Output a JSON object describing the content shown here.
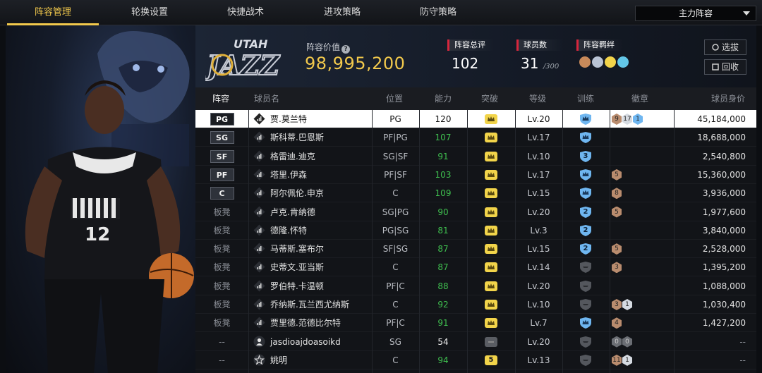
{
  "nav": {
    "tabs": [
      "阵容管理",
      "轮换设置",
      "快捷战术",
      "进攻策略",
      "防守策略"
    ],
    "active_tab": "阵容管理",
    "lineup_select": "主力阵容"
  },
  "summary": {
    "team_logo_text": "UTAH JAZZ",
    "value_label": "阵容价值",
    "value": "98,995,200",
    "overall_label": "阵容总评",
    "overall": "102",
    "players_label": "球员数",
    "players_count": "31",
    "players_max": "/300",
    "bond_label": "阵容羁绊",
    "buttons": {
      "select": "选拔",
      "recycle": "回收"
    }
  },
  "table": {
    "headers": [
      "阵容",
      "球员名",
      "位置",
      "能力",
      "突破",
      "等级",
      "训练",
      "徽章",
      "球员身价"
    ],
    "rows": [
      {
        "slot": "PG",
        "name": "贾.莫兰特",
        "pos": "PG",
        "ability": "120",
        "break": "crown",
        "level": "Lv.20",
        "train": "crown-blue",
        "medals": [
          {
            "t": "bronze",
            "v": "9"
          },
          {
            "t": "silver",
            "v": "17"
          },
          {
            "t": "blue",
            "v": "1"
          }
        ],
        "value": "45,184,000",
        "selected": true,
        "icon": "bars"
      },
      {
        "slot": "SG",
        "name": "斯科蒂.巴恩斯",
        "pos": "PF|PG",
        "ability": "107",
        "break": "crown",
        "level": "Lv.17",
        "train": "crown-blue",
        "medals": [],
        "value": "18,688,000",
        "icon": "bars"
      },
      {
        "slot": "SF",
        "name": "格雷迪.迪克",
        "pos": "SG|SF",
        "ability": "91",
        "break": "crown",
        "level": "Lv.10",
        "train": "3",
        "medals": [],
        "value": "2,540,800",
        "icon": "bars"
      },
      {
        "slot": "PF",
        "name": "塔里.伊森",
        "pos": "PF|SF",
        "ability": "103",
        "break": "crown",
        "level": "Lv.17",
        "train": "crown-blue",
        "medals": [
          {
            "t": "bronze",
            "v": "5"
          }
        ],
        "value": "15,360,000",
        "icon": "bars"
      },
      {
        "slot": "C",
        "name": "阿尔佩伦.申京",
        "pos": "C",
        "ability": "109",
        "break": "crown",
        "level": "Lv.15",
        "train": "crown-blue",
        "medals": [
          {
            "t": "bronze",
            "v": "8"
          }
        ],
        "value": "3,936,000",
        "icon": "bars"
      },
      {
        "slot": "板凳",
        "name": "卢克.肯纳德",
        "pos": "SG|PG",
        "ability": "90",
        "break": "crown",
        "level": "Lv.20",
        "train": "2",
        "medals": [
          {
            "t": "bronze",
            "v": "5"
          }
        ],
        "value": "1,977,600",
        "icon": "bars"
      },
      {
        "slot": "板凳",
        "name": "德隆.怀特",
        "pos": "PG|SG",
        "ability": "81",
        "break": "crown",
        "level": "Lv.3",
        "train": "2",
        "medals": [],
        "value": "3,840,000",
        "icon": "bars"
      },
      {
        "slot": "板凳",
        "name": "马蒂斯.塞布尔",
        "pos": "SF|SG",
        "ability": "87",
        "break": "crown",
        "level": "Lv.15",
        "train": "2",
        "medals": [
          {
            "t": "bronze",
            "v": "5"
          }
        ],
        "value": "2,528,000",
        "icon": "bars"
      },
      {
        "slot": "板凳",
        "name": "史蒂文.亚当斯",
        "pos": "C",
        "ability": "87",
        "break": "crown",
        "level": "Lv.14",
        "train": "gray",
        "medals": [
          {
            "t": "bronze",
            "v": "3"
          }
        ],
        "value": "1,395,200",
        "icon": "bars"
      },
      {
        "slot": "板凳",
        "name": "罗伯特.卡温顿",
        "pos": "PF|C",
        "ability": "88",
        "break": "crown",
        "level": "Lv.20",
        "train": "gray",
        "medals": [],
        "value": "1,088,000",
        "icon": "bars"
      },
      {
        "slot": "板凳",
        "name": "乔纳斯.瓦兰西尤纳斯",
        "pos": "C",
        "ability": "92",
        "break": "crown",
        "level": "Lv.10",
        "train": "gray",
        "medals": [
          {
            "t": "bronze",
            "v": "3"
          },
          {
            "t": "silver",
            "v": "1"
          }
        ],
        "value": "1,030,400",
        "icon": "bars"
      },
      {
        "slot": "板凳",
        "name": "贾里德.范德比尔特",
        "pos": "PF|C",
        "ability": "91",
        "break": "crown",
        "level": "Lv.7",
        "train": "crown-blue",
        "medals": [
          {
            "t": "bronze",
            "v": "4"
          }
        ],
        "value": "1,427,200",
        "icon": "bars"
      },
      {
        "slot": "--",
        "name": "jasdioajdoasoikd",
        "pos": "SG",
        "ability": "54",
        "break": "gray",
        "level": "Lv.20",
        "train": "gray",
        "medals": [
          {
            "t": "gray",
            "v": "0"
          },
          {
            "t": "gray",
            "v": "0"
          }
        ],
        "value": "--",
        "icon": "person"
      },
      {
        "slot": "--",
        "name": "姚明",
        "pos": "C",
        "ability": "94",
        "break": "5",
        "level": "Lv.13",
        "train": "gray",
        "medals": [
          {
            "t": "bronze",
            "v": "11"
          },
          {
            "t": "silver",
            "v": "1"
          }
        ],
        "value": "--",
        "icon": "star"
      }
    ]
  }
}
